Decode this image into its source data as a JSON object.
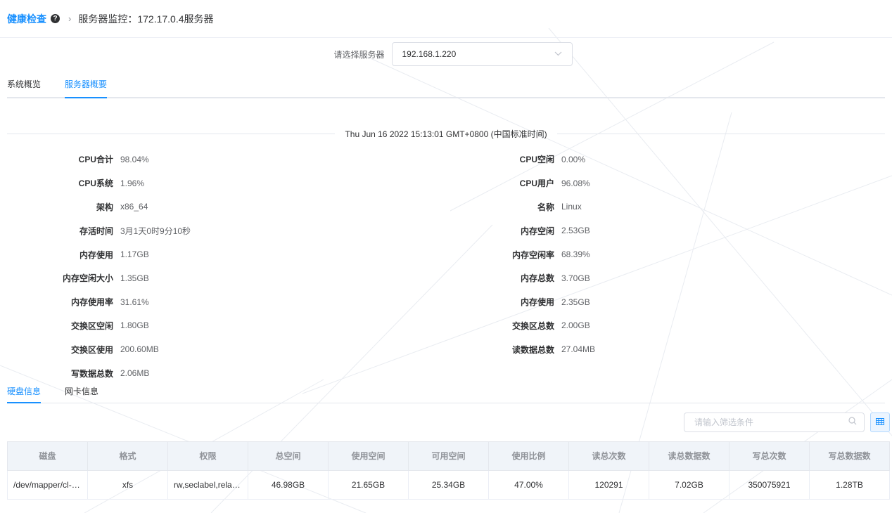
{
  "breadcrumb": {
    "root": "健康检查",
    "current": "服务器监控：172.17.0.4服务器"
  },
  "server_select": {
    "label": "请选择服务器",
    "value": "192.168.1.220"
  },
  "tabs": [
    "系统概览",
    "服务器概要"
  ],
  "timestamp": "Thu Jun 16 2022 15:13:01 GMT+0800 (中国标准时间)",
  "info": [
    {
      "label": "CPU合计",
      "value": "98.04%"
    },
    {
      "label": "CPU空闲",
      "value": "0.00%"
    },
    {
      "label": "CPU系统",
      "value": "1.96%"
    },
    {
      "label": "CPU用户",
      "value": "96.08%"
    },
    {
      "label": "架构",
      "value": "x86_64"
    },
    {
      "label": "名称",
      "value": "Linux"
    },
    {
      "label": "存活时间",
      "value": "3月1天0时9分10秒"
    },
    {
      "label": "内存空闲",
      "value": "2.53GB"
    },
    {
      "label": "内存使用",
      "value": "1.17GB"
    },
    {
      "label": "内存空闲率",
      "value": "68.39%"
    },
    {
      "label": "内存空闲大小",
      "value": "1.35GB"
    },
    {
      "label": "内存总数",
      "value": "3.70GB"
    },
    {
      "label": "内存使用率",
      "value": "31.61%"
    },
    {
      "label": "内存使用",
      "value": "2.35GB"
    },
    {
      "label": "交换区空闲",
      "value": "1.80GB"
    },
    {
      "label": "交换区总数",
      "value": "2.00GB"
    },
    {
      "label": "交换区使用",
      "value": "200.60MB"
    },
    {
      "label": "读数据总数",
      "value": "27.04MB"
    },
    {
      "label": "写数据总数",
      "value": "2.06MB"
    }
  ],
  "disk_tabs": [
    "硬盘信息",
    "网卡信息"
  ],
  "filter": {
    "placeholder": "请输入筛选条件"
  },
  "table": {
    "headers": [
      "磁盘",
      "格式",
      "权限",
      "总空间",
      "使用空间",
      "可用空间",
      "使用比例",
      "读总次数",
      "读总数据数",
      "写总次数",
      "写总数据数"
    ],
    "rows": [
      [
        "/dev/mapper/cl-r…",
        "xfs",
        "rw,seclabel,rela…",
        "46.98GB",
        "21.65GB",
        "25.34GB",
        "47.00%",
        "120291",
        "7.02GB",
        "350075921",
        "1.28TB"
      ]
    ]
  },
  "icons": {
    "help": "question-circle-icon",
    "separator": "chevron-right-icon",
    "select_arrow": "chevron-down-icon",
    "search": "search-icon",
    "columns": "grid-icon"
  },
  "colors": {
    "accent": "#1890ff",
    "text_primary": "#303133",
    "text_secondary": "#606266",
    "header_bg": "#f0f4f9"
  }
}
